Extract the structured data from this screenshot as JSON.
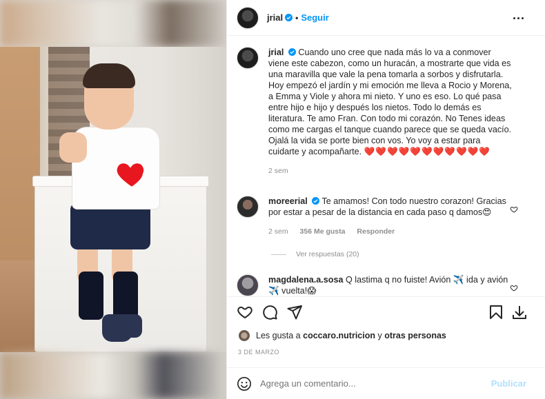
{
  "post": {
    "author": "jrial",
    "follow_label": "Seguir",
    "caption": "Cuando uno cree que nada más lo va a conmover viene este cabezon, como un huracán, a mostrarte que vida es una maravilla que vale la pena tomarla a sorbos y disfrutarla. Hoy empezó el jardín y mi emoción me lleva a Rocio y Morena, a Emma y Viole y ahora mi nieto. Y uno es eso. Lo qué pasa entre hijo e hijo y después los nietos. Todo lo demás es literatura. Te amo Fran. Con todo mi corazón. No Tenes ideas como me cargas el tanque cuando parece que se queda vacío. Ojalá la vida se porte bien con vos. Yo voy a estar para cuidarte y acompañarte.",
    "caption_hearts": "❤️❤️❤️❤️❤️❤️❤️❤️❤️❤️❤️",
    "caption_time": "2 sem"
  },
  "comments": [
    {
      "author": "moreerial",
      "text": "Te amamos! Con todo nuestro corazon! Gracias por estar a pesar de la distancia en cada paso q damos😍",
      "time": "2 sem",
      "likes": "356 Me gusta",
      "reply_label": "Responder",
      "view_replies": "Ver respuestas (20)"
    },
    {
      "author": "magdalena.a.sosa",
      "text": "Q lastima q no fuiste! Avión ✈️ ida y avión ✈️ vuelta!😱"
    }
  ],
  "likes_summary": {
    "prefix": "Les gusta a",
    "user": "coccaro.nutricion",
    "joiner": "y",
    "others": "otras personas"
  },
  "date": "3 DE MARZO",
  "add_comment": {
    "placeholder": "Agrega un comentario...",
    "post_label": "Publicar"
  },
  "colors": {
    "accent": "#0095f6",
    "heart": "#e0245e",
    "muted": "#8e8e8e"
  }
}
